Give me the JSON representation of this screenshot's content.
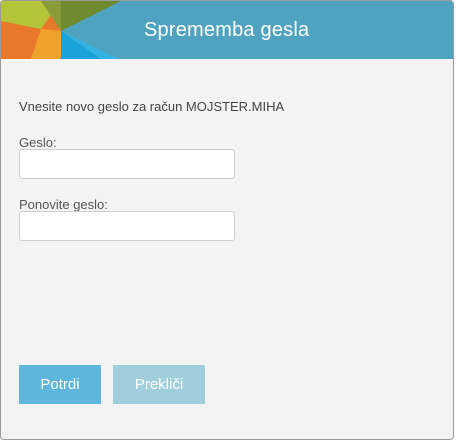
{
  "dialog": {
    "title": "Sprememba gesla",
    "instruction": "Vnesite novo geslo za račun MOJSTER.MIHA",
    "password_label": "Geslo:",
    "password_value": "",
    "repeat_label": "Ponovite geslo:",
    "repeat_value": "",
    "confirm_label": "Potrdi",
    "cancel_label": "Prekliči"
  },
  "colors": {
    "header": "#4fa3c0",
    "panel": "#f3f3f3",
    "confirm_button": "#5fb6dd",
    "cancel_button": "#9fcfdd",
    "logo_orange": "#e8792b",
    "logo_yellow_green": "#b5c33b",
    "logo_olive": "#8a9b3a",
    "logo_cyan": "#1aa3d8"
  },
  "icons": {
    "logo": "multicolor-triangle-logo"
  }
}
